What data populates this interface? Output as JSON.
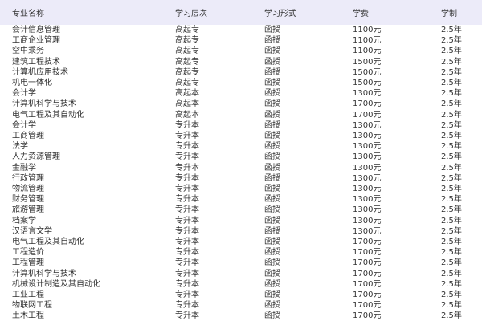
{
  "table": {
    "headers": [
      "专业名称",
      "学习层次",
      "学习形式",
      "学费",
      "学制"
    ],
    "rows": [
      [
        "会计信息管理",
        "高起专",
        "函授",
        "1100元",
        "2.5年"
      ],
      [
        "工商企业管理",
        "高起专",
        "函授",
        "1100元",
        "2.5年"
      ],
      [
        "空中乘务",
        "高起专",
        "函授",
        "1100元",
        "2.5年"
      ],
      [
        "建筑工程技术",
        "高起专",
        "函授",
        "1500元",
        "2.5年"
      ],
      [
        "计算机应用技术",
        "高起专",
        "函授",
        "1500元",
        "2.5年"
      ],
      [
        "机电一体化",
        "高起专",
        "函授",
        "1500元",
        "2.5年"
      ],
      [
        "会计学",
        "高起本",
        "函授",
        "1300元",
        "2.5年"
      ],
      [
        "计算机科学与技术",
        "高起本",
        "函授",
        "1700元",
        "2.5年"
      ],
      [
        "电气工程及其自动化",
        "高起本",
        "函授",
        "1700元",
        "2.5年"
      ],
      [
        "会计学",
        "专升本",
        "函授",
        "1300元",
        "2.5年"
      ],
      [
        "工商管理",
        "专升本",
        "函授",
        "1300元",
        "2.5年"
      ],
      [
        "法学",
        "专升本",
        "函授",
        "1300元",
        "2.5年"
      ],
      [
        "人力资源管理",
        "专升本",
        "函授",
        "1300元",
        "2.5年"
      ],
      [
        "金融学",
        "专升本",
        "函授",
        "1300元",
        "2.5年"
      ],
      [
        "行政管理",
        "专升本",
        "函授",
        "1300元",
        "2.5年"
      ],
      [
        "物流管理",
        "专升本",
        "函授",
        "1300元",
        "2.5年"
      ],
      [
        "财务管理",
        "专升本",
        "函授",
        "1300元",
        "2.5年"
      ],
      [
        "旅游管理",
        "专升本",
        "函授",
        "1300元",
        "2.5年"
      ],
      [
        "档案学",
        "专升本",
        "函授",
        "1300元",
        "2.5年"
      ],
      [
        "汉语言文学",
        "专升本",
        "函授",
        "1300元",
        "2.5年"
      ],
      [
        "电气工程及其自动化",
        "专升本",
        "函授",
        "1700元",
        "2.5年"
      ],
      [
        "工程造价",
        "专升本",
        "函授",
        "1700元",
        "2.5年"
      ],
      [
        "工程管理",
        "专升本",
        "函授",
        "1700元",
        "2.5年"
      ],
      [
        "计算机科学与技术",
        "专升本",
        "函授",
        "1700元",
        "2.5年"
      ],
      [
        "机械设计制造及其自动化",
        "专升本",
        "函授",
        "1700元",
        "2.5年"
      ],
      [
        "工业工程",
        "专升本",
        "函授",
        "1700元",
        "2.5年"
      ],
      [
        "物联网工程",
        "专升本",
        "函授",
        "1700元",
        "2.5年"
      ],
      [
        "土木工程",
        "专升本",
        "函授",
        "1700元",
        "2.5年"
      ]
    ]
  }
}
